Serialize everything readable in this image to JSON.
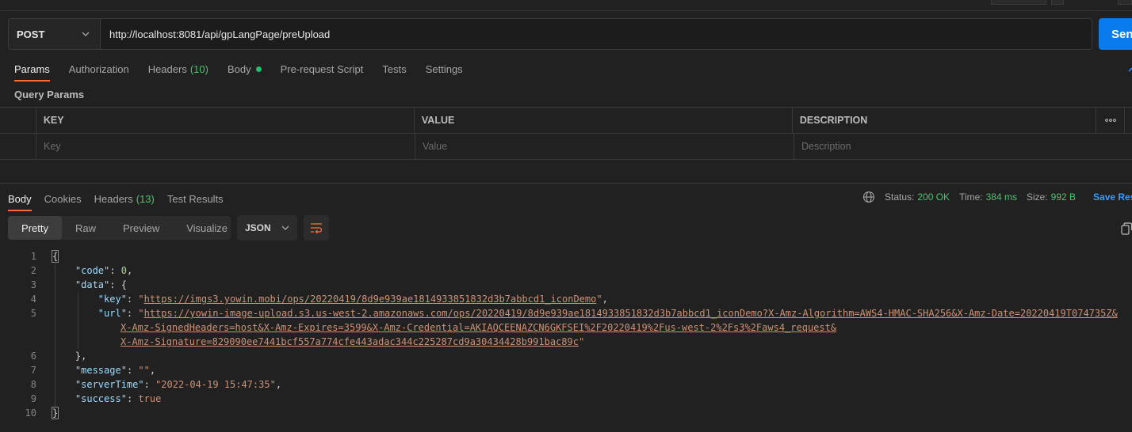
{
  "request": {
    "method": "POST",
    "url": "http://localhost:8081/api/gpLangPage/preUpload",
    "send_label": "Send"
  },
  "request_tabs": [
    {
      "label": "Params",
      "active": true
    },
    {
      "label": "Authorization"
    },
    {
      "label": "Headers",
      "count": "(10)"
    },
    {
      "label": "Body",
      "dot": true
    },
    {
      "label": "Pre-request Script"
    },
    {
      "label": "Tests"
    },
    {
      "label": "Settings"
    }
  ],
  "query_params": {
    "title": "Query Params",
    "columns": {
      "key": "KEY",
      "value": "VALUE",
      "description": "DESCRIPTION",
      "more": "ooo"
    },
    "placeholders": {
      "key": "Key",
      "value": "Value",
      "description": "Description"
    }
  },
  "response_tabs": [
    {
      "label": "Body",
      "active": true
    },
    {
      "label": "Cookies"
    },
    {
      "label": "Headers",
      "count": "(13)"
    },
    {
      "label": "Test Results"
    }
  ],
  "response_status": {
    "status_label": "Status:",
    "status_value": "200 OK",
    "time_label": "Time:",
    "time_value": "384 ms",
    "size_label": "Size:",
    "size_value": "992 B",
    "save_label": "Save Response"
  },
  "view_modes": [
    {
      "label": "Pretty",
      "active": true
    },
    {
      "label": "Raw"
    },
    {
      "label": "Preview"
    },
    {
      "label": "Visualize"
    }
  ],
  "format": "JSON",
  "response_body": {
    "line_numbers": [
      "1",
      "2",
      "3",
      "4",
      "5",
      "6",
      "7",
      "8",
      "9",
      "10"
    ],
    "code": "0",
    "key_url": "https://imgs3.yowin.mobi/ops/20220419/8d9e939ae1814933851832d3b7abbcd1_iconDemo",
    "url_line1": "https://yowin-image-upload.s3.us-west-2.amazonaws.com/ops/20220419/8d9e939ae1814933851832d3b7abbcd1_iconDemo?X-Amz-Algorithm=AWS4-HMAC-SHA256&X-Amz-Date=20220419T074735Z&",
    "url_line2": "X-Amz-SignedHeaders=host&X-Amz-Expires=3599&X-Amz-Credential=AKIAQCEENAZCN6GKFSEI%2F20220419%2Fus-west-2%2Fs3%2Faws4_request&",
    "url_line3": "X-Amz-Signature=829090ee7441bcf557a774cfe443adac344c225287cd9a30434428b991bac89c",
    "message": "",
    "serverTime": "2022-04-19 15:47:35",
    "success": "true"
  },
  "colors": {
    "accent": "#ff6c37",
    "send": "#097bed",
    "success": "#4cc36b",
    "link": "#3b9bff"
  }
}
